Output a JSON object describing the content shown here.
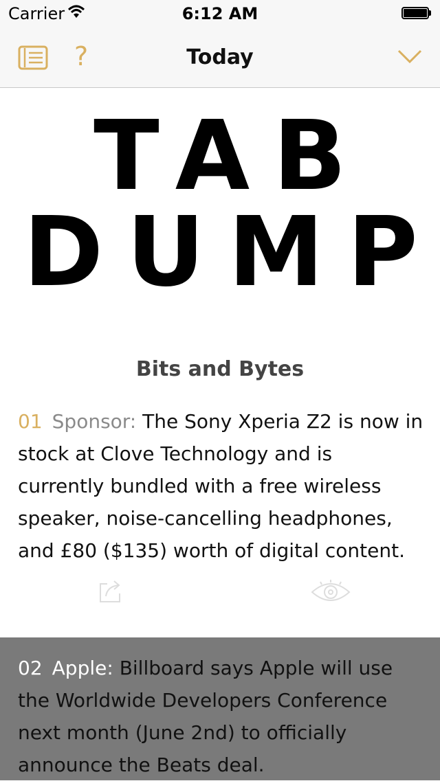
{
  "status_bar": {
    "carrier": "Carrier",
    "time": "6:12 AM"
  },
  "nav": {
    "title": "Today",
    "help_label": "?"
  },
  "logo": {
    "line1": "TAB",
    "line2": "DUMP"
  },
  "section_title": "Bits and Bytes",
  "items": [
    {
      "number": "01",
      "source": "Sponsor:",
      "text": "The Sony Xperia Z2 is now in stock at Clove Technology and is currently bundled with a free wireless speaker, noise-cancelling headphones, and £80 ($135) worth of digital content."
    },
    {
      "number": "02",
      "source": "Apple:",
      "text": "Billboard says Apple will use the Worldwide Developers Conference next month (June 2nd) to officially announce the Beats deal."
    }
  ],
  "colors": {
    "accent": "#d9b060",
    "selected_row_bg": "#7a7a7a",
    "muted": "#8a8a8a"
  },
  "icons": {
    "list": "list-icon",
    "chevron": "chevron-down-icon",
    "share": "share-icon",
    "eye": "eye-icon"
  }
}
